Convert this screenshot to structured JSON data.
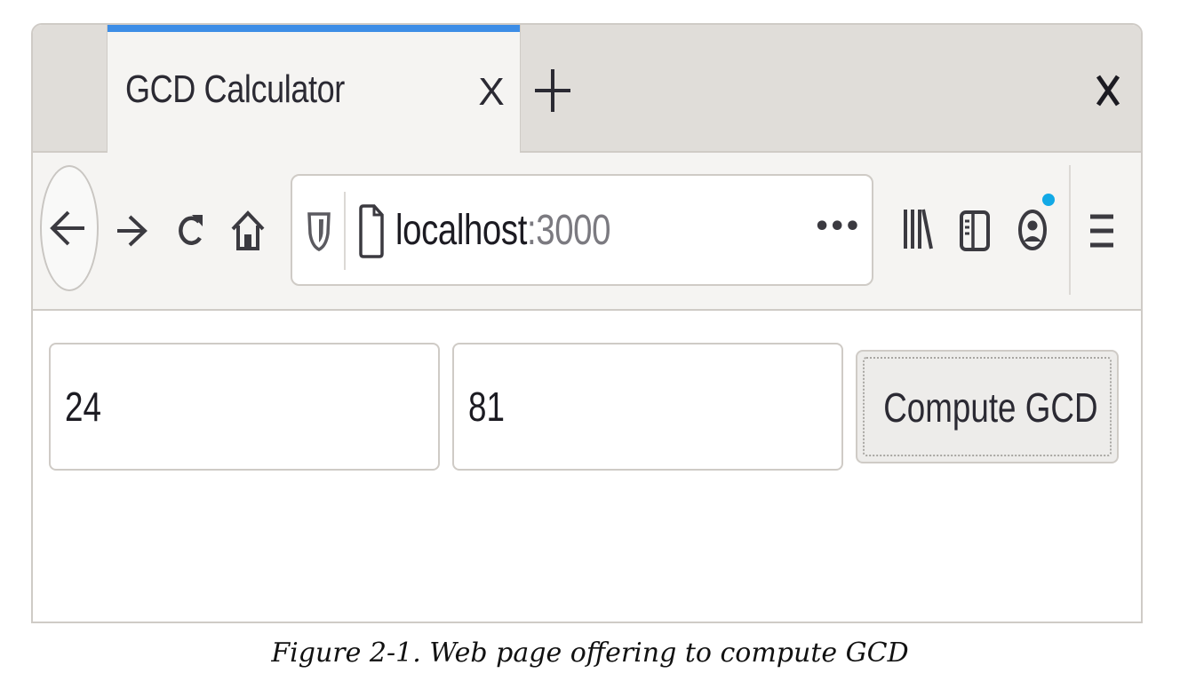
{
  "tab": {
    "title": "GCD Calculator",
    "close_label": "X",
    "accent_color": "#3d8de6"
  },
  "window": {
    "close_label": "X"
  },
  "toolbar": {
    "icons": [
      "back-arrow-icon",
      "forward-arrow-icon",
      "reload-icon",
      "home-icon",
      "library-icon",
      "sidebar-icon",
      "account-icon",
      "menu-icon"
    ]
  },
  "urlbar": {
    "host": "localhost",
    "port": ":3000",
    "more_label": "•••",
    "icons": [
      "shield-icon",
      "page-icon"
    ]
  },
  "form": {
    "first_value": "24",
    "second_value": "81",
    "submit_label": "Compute GCD"
  },
  "caption": "Figure 2-1. Web page offering to compute GCD",
  "colors": {
    "tab_strip": "#e0ddd9",
    "toolbar": "#f5f4f2",
    "border": "#cfcbc6",
    "notification_dot": "#12a9e6"
  }
}
